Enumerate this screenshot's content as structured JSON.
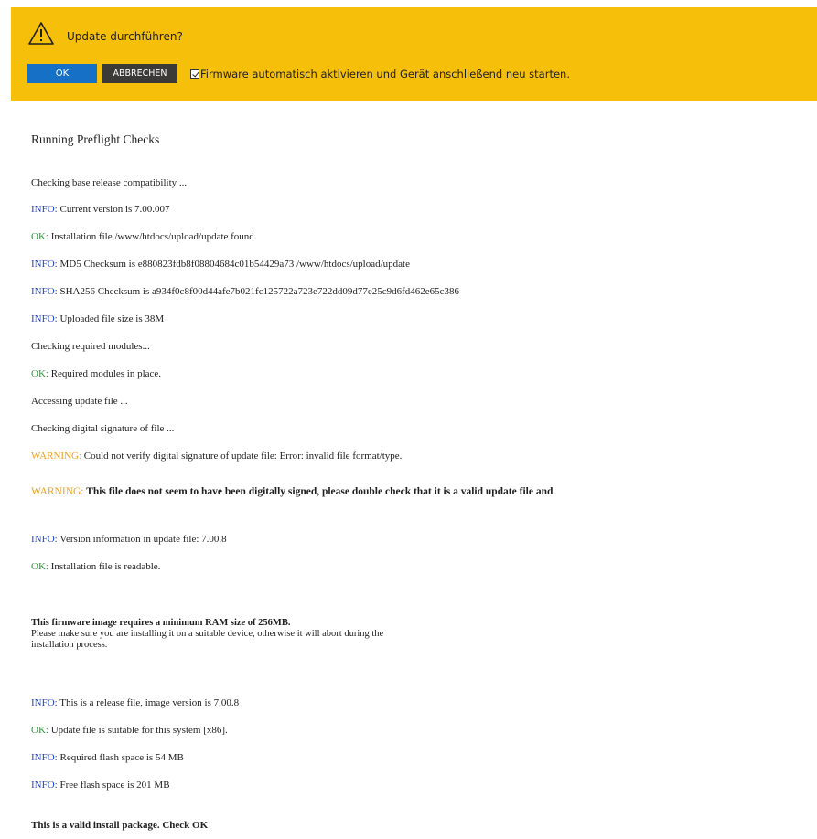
{
  "dialog": {
    "title": "Update durchführen?",
    "ok_label": "OK",
    "cancel_label": "ABBRECHEN",
    "auto_activate_label": "Firmware automatisch aktivieren und Gerät anschließend neu starten.",
    "auto_activate_checked": true,
    "icon": "warning-triangle-icon",
    "background_color": "#f6c00a",
    "ok_color": "#1570c6",
    "cancel_color": "#3b3a37"
  },
  "log": {
    "heading": "Running Preflight Checks",
    "tag_colors": {
      "INFO": "#2547c9",
      "OK": "#2d9a3c",
      "WARNING": "#f0a020"
    },
    "lines": [
      {
        "tag": "",
        "text": "Checking base release compatibility ..."
      },
      {
        "tag": "INFO:",
        "text": " Current version is 7.00.007"
      },
      {
        "tag": "OK:",
        "text": " Installation file /www/htdocs/upload/update found."
      },
      {
        "tag": "INFO:",
        "text": " MD5 Checksum is e880823fdb8f08804684c01b54429a73  /www/htdocs/upload/update"
      },
      {
        "tag": "INFO:",
        "text": " SHA256 Checksum is a934f0c8f00d44afe7b021fc125722a723e722dd09d77e25c9d6fd462e65c386"
      },
      {
        "tag": "INFO:",
        "text": " Uploaded file size is 38M"
      },
      {
        "tag": "",
        "text": "Checking required modules..."
      },
      {
        "tag": "OK:",
        "text": " Required modules in place."
      },
      {
        "tag": "",
        "text": "Accessing update file ..."
      },
      {
        "tag": "",
        "text": "Checking digital signature of file ..."
      },
      {
        "tag": "WARNING:",
        "text": " Could not verify digital signature of update file: Error: invalid file format/type."
      },
      {
        "tag": "WARNING:",
        "text": " This file does not seem to have been digitally signed, please double check that it is a valid update file and",
        "bold": true
      },
      {
        "tag": "INFO:",
        "text": " Version information in update file: 7.00.8"
      },
      {
        "tag": "OK:",
        "text": " Installation file is readable."
      }
    ],
    "ram_notice": {
      "headline": "This firmware image requires a minimum RAM size of 256MB.",
      "line1": "Please make sure you are installing it on a suitable device, otherwise it will abort during the",
      "line2": "installation process."
    },
    "lines2": [
      {
        "tag": "INFO:",
        "text": " This is a release file, image version is 7.00.8"
      },
      {
        "tag": "OK:",
        "text": " Update file is suitable for this system [x86]."
      },
      {
        "tag": "INFO:",
        "text": " Required flash space is 54 MB"
      },
      {
        "tag": "INFO:",
        "text": " Free flash space is 201 MB"
      }
    ],
    "final": "This is a valid install package. Check OK"
  }
}
